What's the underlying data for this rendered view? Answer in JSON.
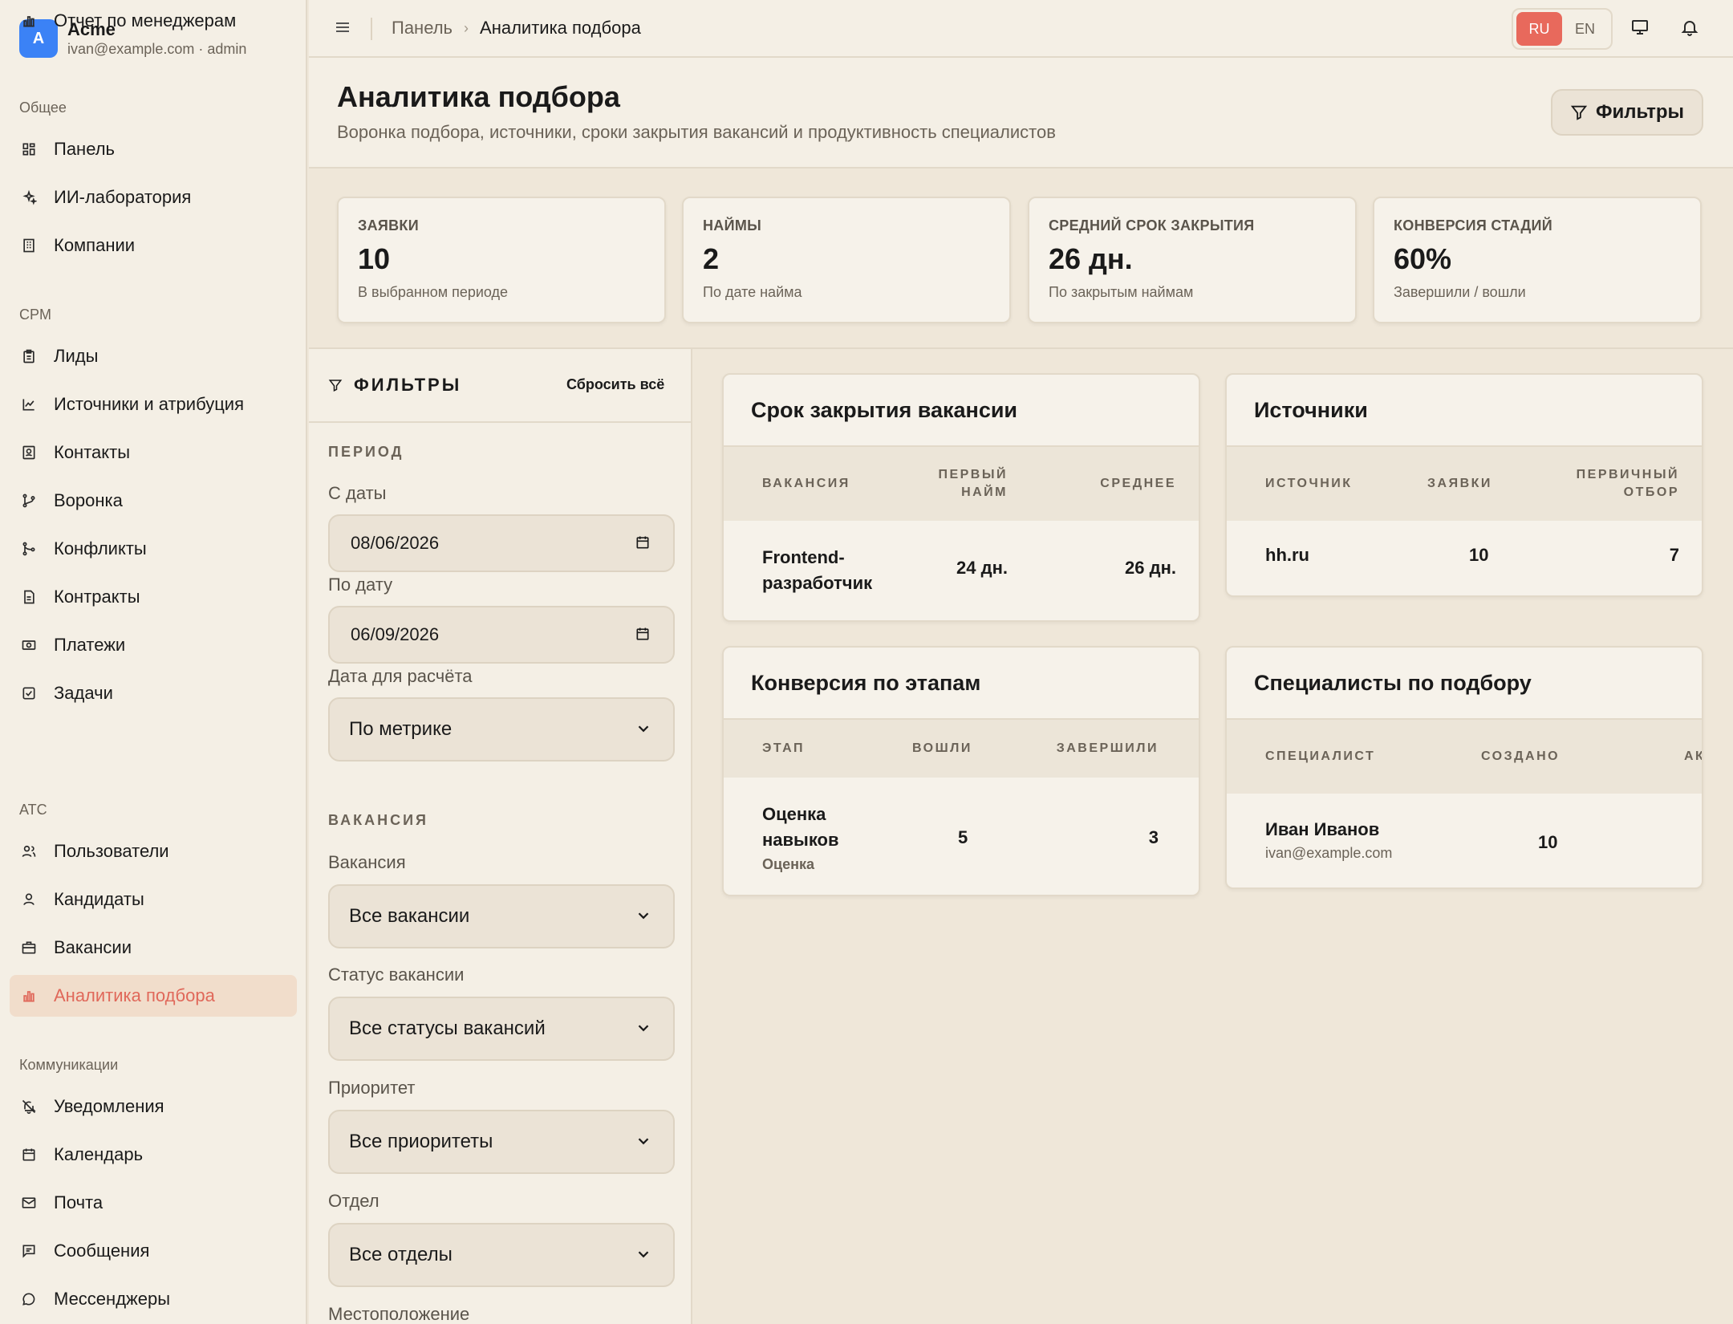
{
  "brand": {
    "logo": "A",
    "name": "Acme",
    "sub": "ivan@example.com · admin"
  },
  "sidebar": {
    "sections": [
      {
        "title": "Общее",
        "items": [
          {
            "label": "Панель",
            "icon": "dashboard-icon"
          },
          {
            "label": "ИИ-лаборатория",
            "icon": "sparkles-icon"
          },
          {
            "label": "Компании",
            "icon": "building-icon"
          }
        ]
      },
      {
        "title": "CPM",
        "items": [
          {
            "label": "Лиды",
            "icon": "clipboard-icon"
          },
          {
            "label": "Источники и атрибуция",
            "icon": "chart-line-icon"
          },
          {
            "label": "Контакты",
            "icon": "contact-card-icon"
          },
          {
            "label": "Воронка",
            "icon": "git-branch-icon"
          },
          {
            "label": "Конфликты",
            "icon": "git-merge-icon"
          },
          {
            "label": "Контракты",
            "icon": "document-icon"
          },
          {
            "label": "Платежи",
            "icon": "banknote-icon"
          },
          {
            "label": "Задачи",
            "icon": "checkbox-icon"
          },
          {
            "label": "Отчет по менеджерам",
            "icon": "bar-chart-icon"
          }
        ]
      },
      {
        "title": "ATC",
        "items": [
          {
            "label": "Пользователи",
            "icon": "users-icon"
          },
          {
            "label": "Кандидаты",
            "icon": "user-icon"
          },
          {
            "label": "Вакансии",
            "icon": "briefcase-icon"
          },
          {
            "label": "Аналитика подбора",
            "icon": "bar-chart-icon",
            "active": true
          }
        ]
      },
      {
        "title": "Коммуникации",
        "items": [
          {
            "label": "Уведомления",
            "icon": "bell-off-icon"
          },
          {
            "label": "Календарь",
            "icon": "calendar-icon"
          },
          {
            "label": "Почта",
            "icon": "mail-icon"
          },
          {
            "label": "Сообщения",
            "icon": "message-square-icon"
          },
          {
            "label": "Мессенджеры",
            "icon": "message-circle-icon"
          }
        ]
      }
    ]
  },
  "topbar": {
    "breadcrumb_root": "Панель",
    "breadcrumb_current": "Аналитика подбора",
    "lang_ru": "RU",
    "lang_en": "EN",
    "accent": "#e8695c"
  },
  "header": {
    "title": "Аналитика подбора",
    "subtitle": "Воронка подбора, источники, сроки закрытия вакансий и продуктивность специалистов",
    "filters_button": "Фильтры"
  },
  "kpis": [
    {
      "label": "ЗАЯВКИ",
      "value": "10",
      "note": "В выбранном периоде"
    },
    {
      "label": "НАЙМЫ",
      "value": "2",
      "note": "По дате найма"
    },
    {
      "label": "СРЕДНИЙ СРОК ЗАКРЫТИЯ",
      "value": "26 дн.",
      "note": "По закрытым наймам"
    },
    {
      "label": "КОНВЕРСИЯ СТАДИЙ",
      "value": "60%",
      "note": "Завершили / вошли"
    }
  ],
  "filters": {
    "title": "ФИЛЬТРЫ",
    "reset": "Сбросить всё",
    "period_section": "ПЕРИОД",
    "from_label": "С даты",
    "from_value": "08/06/2026",
    "to_label": "По дату",
    "to_value": "06/09/2026",
    "calc_label": "Дата для расчёта",
    "calc_value": "По метрике",
    "vacancy_section": "ВАКАНСИЯ",
    "vacancy_label": "Вакансия",
    "vacancy_value": "Все вакансии",
    "status_label": "Статус вакансии",
    "status_value": "Все статусы вакансий",
    "priority_label": "Приоритет",
    "priority_value": "Все приоритеты",
    "department_label": "Отдел",
    "department_value": "Все отделы",
    "location_label": "Местоположение"
  },
  "close_time": {
    "title": "Срок закрытия вакансии",
    "col_vacancy": "ВАКАНСИЯ",
    "col_first_1": "ПЕРВЫЙ",
    "col_first_2": "НАЙМ",
    "col_avg": "СРЕДНЕЕ",
    "row_vacancy_1": "Frontend-",
    "row_vacancy_2": "разработчик",
    "row_first": "24 дн.",
    "row_avg": "26 дн."
  },
  "sources": {
    "title": "Источники",
    "col_source": "ИСТОЧНИК",
    "col_apps": "ЗАЯВКИ",
    "col_screen_1": "ПЕРВИЧНЫЙ",
    "col_screen_2": "ОТБОР",
    "row_source": "hh.ru",
    "row_apps": "10",
    "row_screen": "7"
  },
  "conversion": {
    "title": "Конверсия по этапам",
    "col_stage": "ЭТАП",
    "col_in": "ВОШЛИ",
    "col_done": "ЗАВЕРШИЛИ",
    "row_stage_1": "Оценка",
    "row_stage_2": "навыков",
    "row_stage_type": "Оценка",
    "row_in": "5",
    "row_done": "3"
  },
  "specialists": {
    "title": "Специалисты по подбору",
    "col_spec": "СПЕЦИАЛИСТ",
    "col_created": "СОЗДАНО",
    "col_active": "АКТИВ",
    "row_name": "Иван Иванов",
    "row_email": "ivan@example.com",
    "row_created": "10"
  }
}
